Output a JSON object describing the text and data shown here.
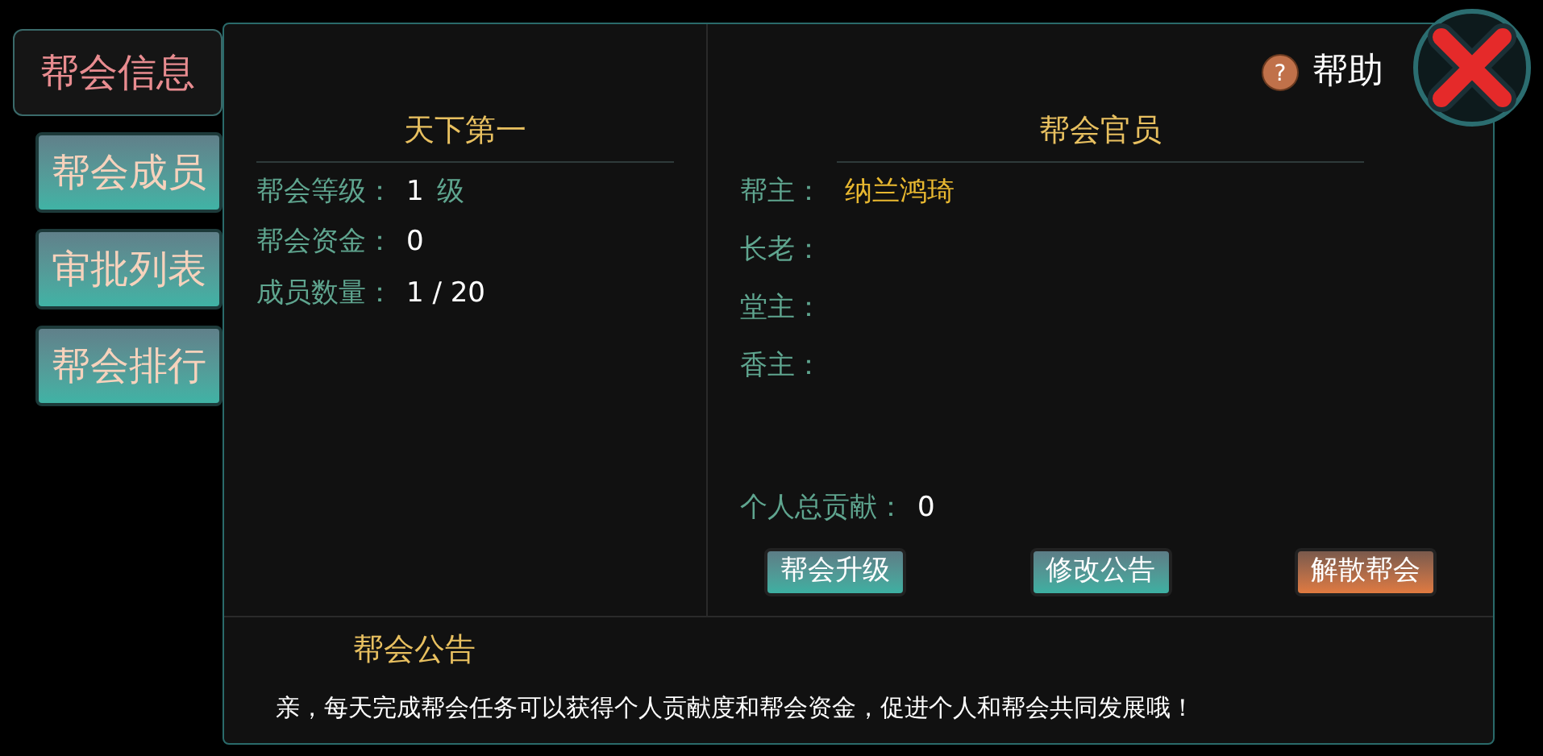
{
  "tabs": [
    {
      "label": "帮会信息",
      "selected": true
    },
    {
      "label": "帮会成员",
      "selected": false
    },
    {
      "label": "审批列表",
      "selected": false
    },
    {
      "label": "帮会排行",
      "selected": false
    }
  ],
  "help": {
    "icon": "?",
    "label": "帮助"
  },
  "guild_info": {
    "title": "天下第一",
    "rows": [
      {
        "label": "帮会等级：",
        "value": "1",
        "unit": "级"
      },
      {
        "label": "帮会资金：",
        "value": "0"
      },
      {
        "label": "成员数量：",
        "value": "1 / 20"
      }
    ]
  },
  "officers": {
    "title": "帮会官员",
    "rows": [
      {
        "label": "帮主：",
        "value": "纳兰鸿琦"
      },
      {
        "label": "长老："
      },
      {
        "label": "堂主："
      },
      {
        "label": "香主："
      }
    ]
  },
  "contribution": {
    "label": "个人总贡献：",
    "value": "0"
  },
  "buttons": [
    {
      "label": "帮会升级",
      "kind": "normal"
    },
    {
      "label": "修改公告",
      "kind": "normal"
    },
    {
      "label": "解散帮会",
      "kind": "danger"
    }
  ],
  "notice": {
    "title": "帮会公告",
    "text": "亲，每天完成帮会任务可以获得个人贡献度和帮会资金，促进个人和帮会共同发展哦！"
  }
}
